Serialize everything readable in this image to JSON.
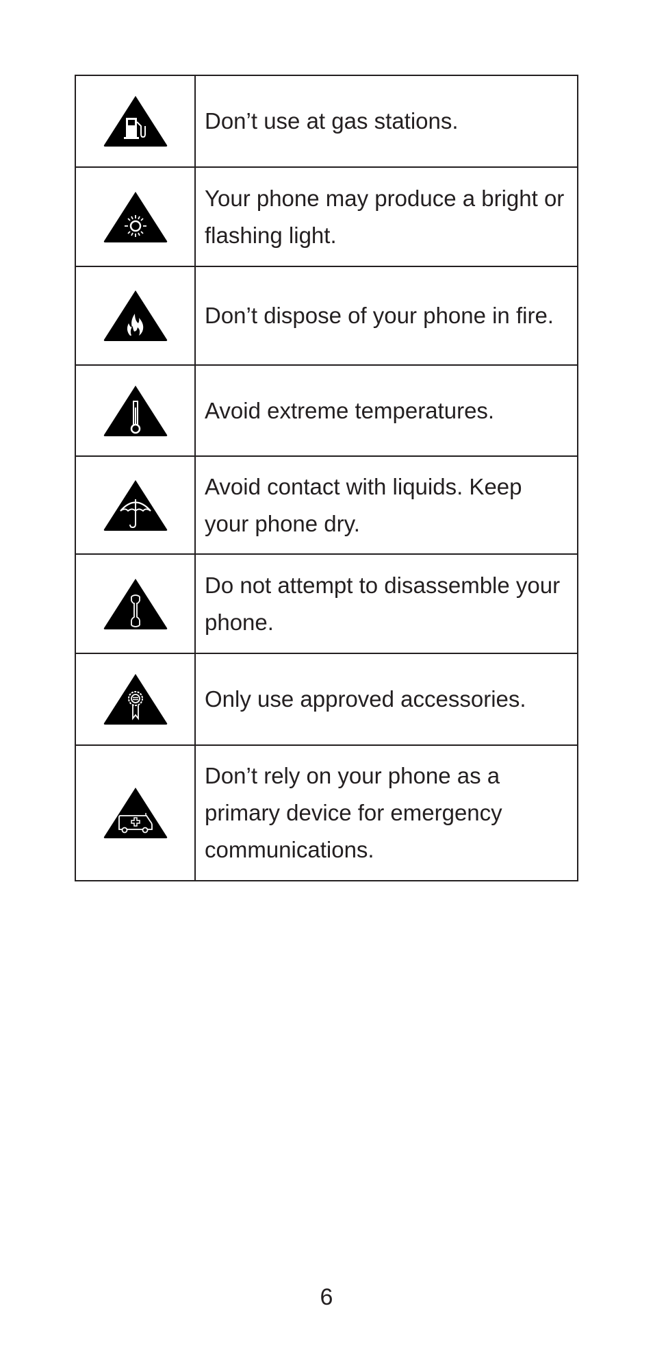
{
  "safety_table": {
    "rows": [
      {
        "icon": "gas-pump-icon",
        "text": "Don’t use at gas stations."
      },
      {
        "icon": "bright-light-icon",
        "text": "Your phone may produce a bright or flashing light."
      },
      {
        "icon": "fire-icon",
        "text": "Don’t dispose of your phone in fire."
      },
      {
        "icon": "thermometer-icon",
        "text": "Avoid extreme temperatures."
      },
      {
        "icon": "umbrella-icon",
        "text": "Avoid contact with liquids. Keep your phone dry."
      },
      {
        "icon": "wrench-icon",
        "text": "Do not attempt to disassemble your phone."
      },
      {
        "icon": "approved-badge-icon",
        "text": "Only use approved accessories."
      },
      {
        "icon": "ambulance-icon",
        "text": "Don’t rely on your phone as a primary device for emergency communications."
      }
    ]
  },
  "footer": {
    "page_number": "6"
  }
}
